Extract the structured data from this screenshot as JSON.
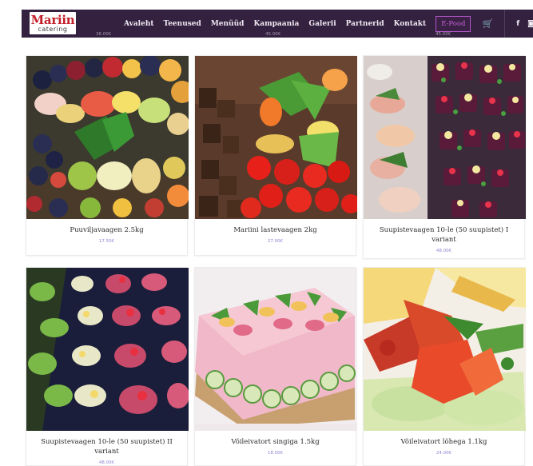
{
  "brand": {
    "name": "Mariin",
    "tagline": "catering",
    "color": "#c21f2a"
  },
  "nav": {
    "items": [
      "Avaleht",
      "Teenused",
      "Menüüd",
      "Kampaania",
      "Galerii",
      "Partnerid",
      "Kontakt"
    ],
    "eshop_label": "E-Pood",
    "cart_icon": "shopping-cart-icon",
    "social": [
      "f",
      "◙"
    ],
    "background": "#34203f",
    "accent": "#b257c8"
  },
  "top_prices": [
    "36.00€",
    "45.00€",
    "45.00€"
  ],
  "products": [
    {
      "title": "Puuviljavaagen 2.5kg",
      "price": "17.50€"
    },
    {
      "title": "Mariini lastevaagen 2kg",
      "price": "27.00€"
    },
    {
      "title": "Suupistevaagen 10-le (50 suupistet) I variant",
      "price": "48.00€"
    },
    {
      "title": "Suupistevaagen 10-le (50 suupistet) II variant",
      "price": "48.00€"
    },
    {
      "title": "Võileivatort singiga 1.5kg",
      "price": "18.00€"
    },
    {
      "title": "Võileivatort lõhega 1.1kg",
      "price": "24.00€"
    }
  ]
}
